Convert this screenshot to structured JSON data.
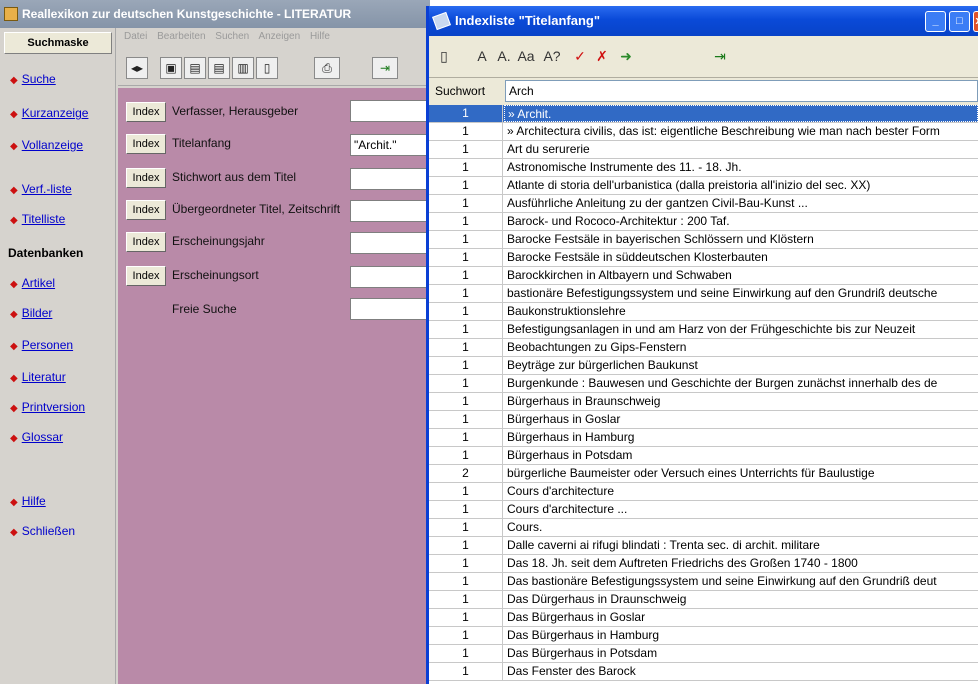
{
  "bg_window": {
    "title": "Reallexikon zur deutschen Kunstgeschichte - LITERATUR",
    "suchmaske_label": "Suchmaske",
    "menu": [
      "Datei",
      "Bearbeiten",
      "Suchen",
      "Anzeigen",
      "Hilfe"
    ],
    "nav": {
      "suche": "Suche",
      "kurzanzeige": "Kurzanzeige",
      "vollanzeige": "Vollanzeige",
      "verf_liste": "Verf.-liste",
      "titelliste": "Titelliste",
      "datenbanken_heading": "Datenbanken",
      "artikel": "Artikel",
      "bilder": "Bilder",
      "personen": "Personen",
      "literatur": "Literatur",
      "printversion": "Printversion",
      "glossar": "Glossar",
      "hilfe": "Hilfe",
      "schliessen": "Schließen"
    },
    "form": {
      "index_label": "Index",
      "fields": [
        {
          "label": "Verfasser, Herausgeber",
          "value": ""
        },
        {
          "label": "Titelanfang",
          "value": "\"Archit.\""
        },
        {
          "label": "Stichwort aus dem Titel",
          "value": ""
        },
        {
          "label": "Übergeordneter Titel, Zeitschrift",
          "value": ""
        },
        {
          "label": "Erscheinungsjahr",
          "value": ""
        },
        {
          "label": "Erscheinungsort",
          "value": ""
        }
      ],
      "freie_suche_label": "Freie Suche",
      "freie_suche_value": ""
    }
  },
  "index_window": {
    "title": "Indexliste \"Titelanfang\"",
    "search_label": "Suchwort",
    "search_value": "Arch",
    "rows": [
      {
        "count": "1",
        "title": "» Archit."
      },
      {
        "count": "1",
        "title": "» Architectura civilis, das ist: eigentliche Beschreibung wie man nach bester Form"
      },
      {
        "count": "1",
        "title": "Art du serurerie"
      },
      {
        "count": "1",
        "title": "Astronomische Instrumente des 11. - 18. Jh."
      },
      {
        "count": "1",
        "title": "Atlante di storia dell'urbanistica (dalla preistoria all'inizio del sec. XX)"
      },
      {
        "count": "1",
        "title": "Ausführliche Anleitung zu der gantzen Civil-Bau-Kunst ..."
      },
      {
        "count": "1",
        "title": "Barock- und Rococo-Architektur : 200 Taf."
      },
      {
        "count": "1",
        "title": "Barocke Festsäle in bayerischen Schlössern und Klöstern"
      },
      {
        "count": "1",
        "title": "Barocke Festsäle in süddeutschen Klosterbauten"
      },
      {
        "count": "1",
        "title": "Barockkirchen in Altbayern und Schwaben"
      },
      {
        "count": "1",
        "title": "bastionäre Befestigungssystem und seine Einwirkung auf den Grundriß deutsche"
      },
      {
        "count": "1",
        "title": "Baukonstruktionslehre"
      },
      {
        "count": "1",
        "title": "Befestigungsanlagen in und am Harz von der Frühgeschichte bis zur Neuzeit"
      },
      {
        "count": "1",
        "title": "Beobachtungen zu Gips-Fenstern"
      },
      {
        "count": "1",
        "title": "Beyträge zur bürgerlichen Baukunst"
      },
      {
        "count": "1",
        "title": "Burgenkunde : Bauwesen und Geschichte der Burgen zunächst innerhalb des de"
      },
      {
        "count": "1",
        "title": "Bürgerhaus in Braunschweig"
      },
      {
        "count": "1",
        "title": "Bürgerhaus in Goslar"
      },
      {
        "count": "1",
        "title": "Bürgerhaus in Hamburg"
      },
      {
        "count": "1",
        "title": "Bürgerhaus in Potsdam"
      },
      {
        "count": "2",
        "title": "bürgerliche Baumeister oder Versuch eines Unterrichts für Baulustige"
      },
      {
        "count": "1",
        "title": "Cours d'architecture"
      },
      {
        "count": "1",
        "title": "Cours d'architecture ..."
      },
      {
        "count": "1",
        "title": "Cours."
      },
      {
        "count": "1",
        "title": "Dalle caverni ai rifugi blindati : Trenta sec. di archit. militare"
      },
      {
        "count": "1",
        "title": "Das 18. Jh. seit dem Auftreten Friedrichs des Großen 1740 - 1800"
      },
      {
        "count": "1",
        "title": "Das bastionäre Befestigungssystem und seine Einwirkung auf den Grundriß deut"
      },
      {
        "count": "1",
        "title": "Das Dürgerhaus in Draunschweig"
      },
      {
        "count": "1",
        "title": "Das Bürgerhaus in Goslar"
      },
      {
        "count": "1",
        "title": "Das Bürgerhaus in Hamburg"
      },
      {
        "count": "1",
        "title": "Das Bürgerhaus in Potsdam"
      },
      {
        "count": "1",
        "title": "Das Fenster des Barock"
      }
    ]
  }
}
